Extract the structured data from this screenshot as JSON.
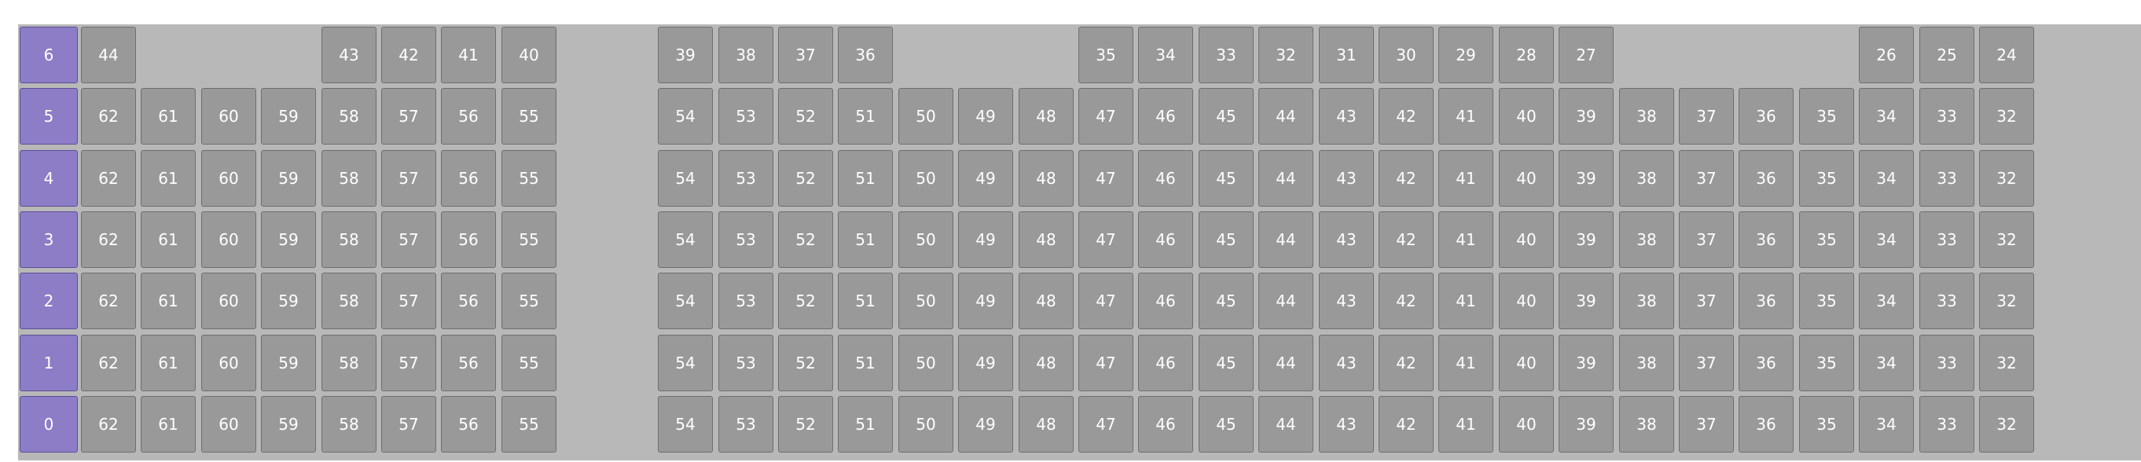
{
  "colors": {
    "panel_bg": "#b8b8b8",
    "cell_bg": "#999999",
    "cell_border": "#6e6e6e",
    "cell_text": "#ffffff",
    "row_header_bg": "#8d7cc6"
  },
  "rows": [
    {
      "label": "6",
      "cells": [
        "44",
        "",
        "",
        "",
        "43",
        "42",
        "41",
        "40",
        "39",
        "38",
        "37",
        "36",
        "",
        "",
        "",
        "35",
        "34",
        "33",
        "32",
        "31",
        "30",
        "29",
        "28",
        "27",
        "",
        "",
        "",
        "",
        "26",
        "25",
        "24"
      ]
    },
    {
      "label": "5",
      "cells": [
        "62",
        "61",
        "60",
        "59",
        "58",
        "57",
        "56",
        "55",
        "54",
        "53",
        "52",
        "51",
        "50",
        "49",
        "48",
        "47",
        "46",
        "45",
        "44",
        "43",
        "42",
        "41",
        "40",
        "39",
        "38",
        "37",
        "36",
        "35",
        "34",
        "33",
        "32"
      ]
    },
    {
      "label": "4",
      "cells": [
        "62",
        "61",
        "60",
        "59",
        "58",
        "57",
        "56",
        "55",
        "54",
        "53",
        "52",
        "51",
        "50",
        "49",
        "48",
        "47",
        "46",
        "45",
        "44",
        "43",
        "42",
        "41",
        "40",
        "39",
        "38",
        "37",
        "36",
        "35",
        "34",
        "33",
        "32"
      ]
    },
    {
      "label": "3",
      "cells": [
        "62",
        "61",
        "60",
        "59",
        "58",
        "57",
        "56",
        "55",
        "54",
        "53",
        "52",
        "51",
        "50",
        "49",
        "48",
        "47",
        "46",
        "45",
        "44",
        "43",
        "42",
        "41",
        "40",
        "39",
        "38",
        "37",
        "36",
        "35",
        "34",
        "33",
        "32"
      ]
    },
    {
      "label": "2",
      "cells": [
        "62",
        "61",
        "60",
        "59",
        "58",
        "57",
        "56",
        "55",
        "54",
        "53",
        "52",
        "51",
        "50",
        "49",
        "48",
        "47",
        "46",
        "45",
        "44",
        "43",
        "42",
        "41",
        "40",
        "39",
        "38",
        "37",
        "36",
        "35",
        "34",
        "33",
        "32"
      ]
    },
    {
      "label": "1",
      "cells": [
        "62",
        "61",
        "60",
        "59",
        "58",
        "57",
        "56",
        "55",
        "54",
        "53",
        "52",
        "51",
        "50",
        "49",
        "48",
        "47",
        "46",
        "45",
        "44",
        "43",
        "42",
        "41",
        "40",
        "39",
        "38",
        "37",
        "36",
        "35",
        "34",
        "33",
        "32"
      ]
    },
    {
      "label": "0",
      "cells": [
        "62",
        "61",
        "60",
        "59",
        "58",
        "57",
        "56",
        "55",
        "54",
        "53",
        "52",
        "51",
        "50",
        "49",
        "48",
        "47",
        "46",
        "45",
        "44",
        "43",
        "42",
        "41",
        "40",
        "39",
        "38",
        "37",
        "36",
        "35",
        "34",
        "33",
        "32"
      ]
    }
  ]
}
